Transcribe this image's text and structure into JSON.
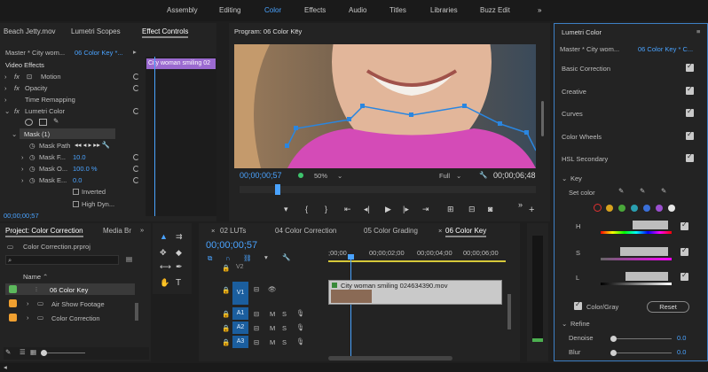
{
  "workspaces": [
    "Assembly",
    "Editing",
    "Color",
    "Effects",
    "Audio",
    "Titles",
    "Libraries",
    "Buzz Edit"
  ],
  "workspace_active": "Color",
  "more_icon": "chevron-double-right-icon",
  "source_tabs": [
    "Beach Jetty.mov",
    "Lumetri Scopes",
    "Effect Controls"
  ],
  "effect_controls": {
    "master": "Master * City wom...",
    "clip": "06 Color Key *...",
    "clip_timeline_label": "City woman smiling 02",
    "section": "Video Effects",
    "effects": [
      "Motion",
      "Opacity",
      "Time Remapping",
      "Lumetri Color"
    ],
    "mask": "Mask (1)",
    "mask_params": [
      {
        "label": "Mask Path",
        "value": ""
      },
      {
        "label": "Mask F...",
        "value": "10.0"
      },
      {
        "label": "Mask O...",
        "value": "100.0 %"
      },
      {
        "label": "Mask E...",
        "value": "0.0"
      }
    ],
    "inverted": "Inverted",
    "high_dynamic": "High Dyn...",
    "timecode": "00;00;00;57"
  },
  "program": {
    "title": "Program: 06 Color Key",
    "menu_icon": "hamburger-menu-icon",
    "timecode": "00;00;00;57",
    "zoom": "50%",
    "quality": "Full",
    "duration": "00;00;06;48"
  },
  "project": {
    "tabs": [
      "Project: Color Correction",
      "Media Br"
    ],
    "file": "Color Correction.prproj",
    "col_name": "Name",
    "items": [
      {
        "name": "06 Color Key",
        "color": "#5cb85c"
      },
      {
        "name": "Air Show Footage",
        "color": "#f0a030"
      },
      {
        "name": "Color Correction",
        "color": "#f0a030"
      }
    ]
  },
  "timeline": {
    "tabs": [
      "02 LUTs",
      "04 Color Correction",
      "05 Color Grading",
      "06 Color Key"
    ],
    "timecode": "00;00;00;57",
    "ruler": [
      ";00;00",
      "00;00;02;00",
      "00;00;04;00",
      "00;00;06;00"
    ],
    "video_tracks": [
      "V2",
      "V1"
    ],
    "audio_tracks": [
      "A1",
      "A2",
      "A3"
    ],
    "clip": "City woman smiling 024634390.mov",
    "track_flags": [
      "M",
      "S"
    ]
  },
  "lumetri": {
    "title": "Lumetri Color",
    "master": "Master * City wom...",
    "clip": "06 Color Key * C...",
    "sections": [
      "Basic Correction",
      "Creative",
      "Curves",
      "Color Wheels",
      "HSL Secondary"
    ],
    "key": "Key",
    "set_color": "Set color",
    "hsl_labels": [
      "H",
      "S",
      "L"
    ],
    "color_gray": "Color/Gray",
    "reset": "Reset",
    "refine": "Refine",
    "denoise": {
      "label": "Denoise",
      "value": "0.0"
    },
    "blur": {
      "label": "Blur",
      "value": "0.0"
    },
    "swatch_colors": [
      "#d93a3a",
      "#d8a21e",
      "#4aa83a",
      "#2a9fb0",
      "#3a6fd8",
      "#9b4fd0",
      "#e6e6e6"
    ]
  }
}
